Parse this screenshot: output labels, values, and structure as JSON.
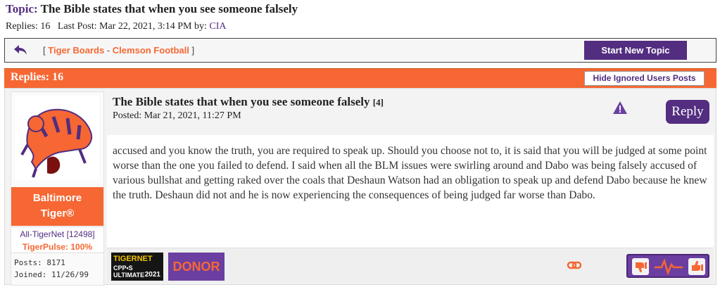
{
  "topic": {
    "label": "Topic:",
    "title": "The Bible states that when you see someone falsely",
    "replies_text": "Replies: 16",
    "last_post_text": "Last Post: Mar 22, 2021, 3:14 PM by:",
    "last_post_user": "CIA"
  },
  "nav": {
    "back_icon": "back-arrow-icon",
    "crumb_open": "[",
    "crumb_sep": "-",
    "crumb_close": "]",
    "board1": "Tiger Boards",
    "board2": "Clemson Football",
    "start_button": "Start New Topic"
  },
  "replies_bar": {
    "label": "Replies: 16",
    "hide_button": "Hide Ignored Users Posts"
  },
  "post": {
    "title": "The Bible states that when you see someone falsely",
    "reply_count": "[4]",
    "posted": "Posted: Mar 21, 2021, 11:27 PM",
    "reply_button": "Reply",
    "body": "accused and you know the truth, you are required to speak up. Should you choose not to, it is said that you will be judged at some point worse than the one you failed to defend. I said when all the BLM issues were swirling around and Dabo was being falsely accused of various bullshat and getting raked over the coals that Deshaun Watson had an obligation to speak up and defend Dabo because he knew the truth. Deshaun did not and he is now experiencing the consequences of being judged far worse than Dabo.",
    "user": {
      "name_line1": "Baltimore",
      "name_line2": "Tiger®",
      "rank": "All-TigerNet [12498]",
      "pulse": "TigerPulse: 100%",
      "posts": "Posts: 8171",
      "joined": "Joined: 11/26/99"
    },
    "badges": {
      "badge1_title": "TIGERNET",
      "badge1_sub": "CPP•S ULTIMATE",
      "badge1_year": "2021",
      "badge2_text": "DONOR"
    }
  },
  "colors": {
    "purple": "#522d80",
    "orange": "#f66733"
  }
}
